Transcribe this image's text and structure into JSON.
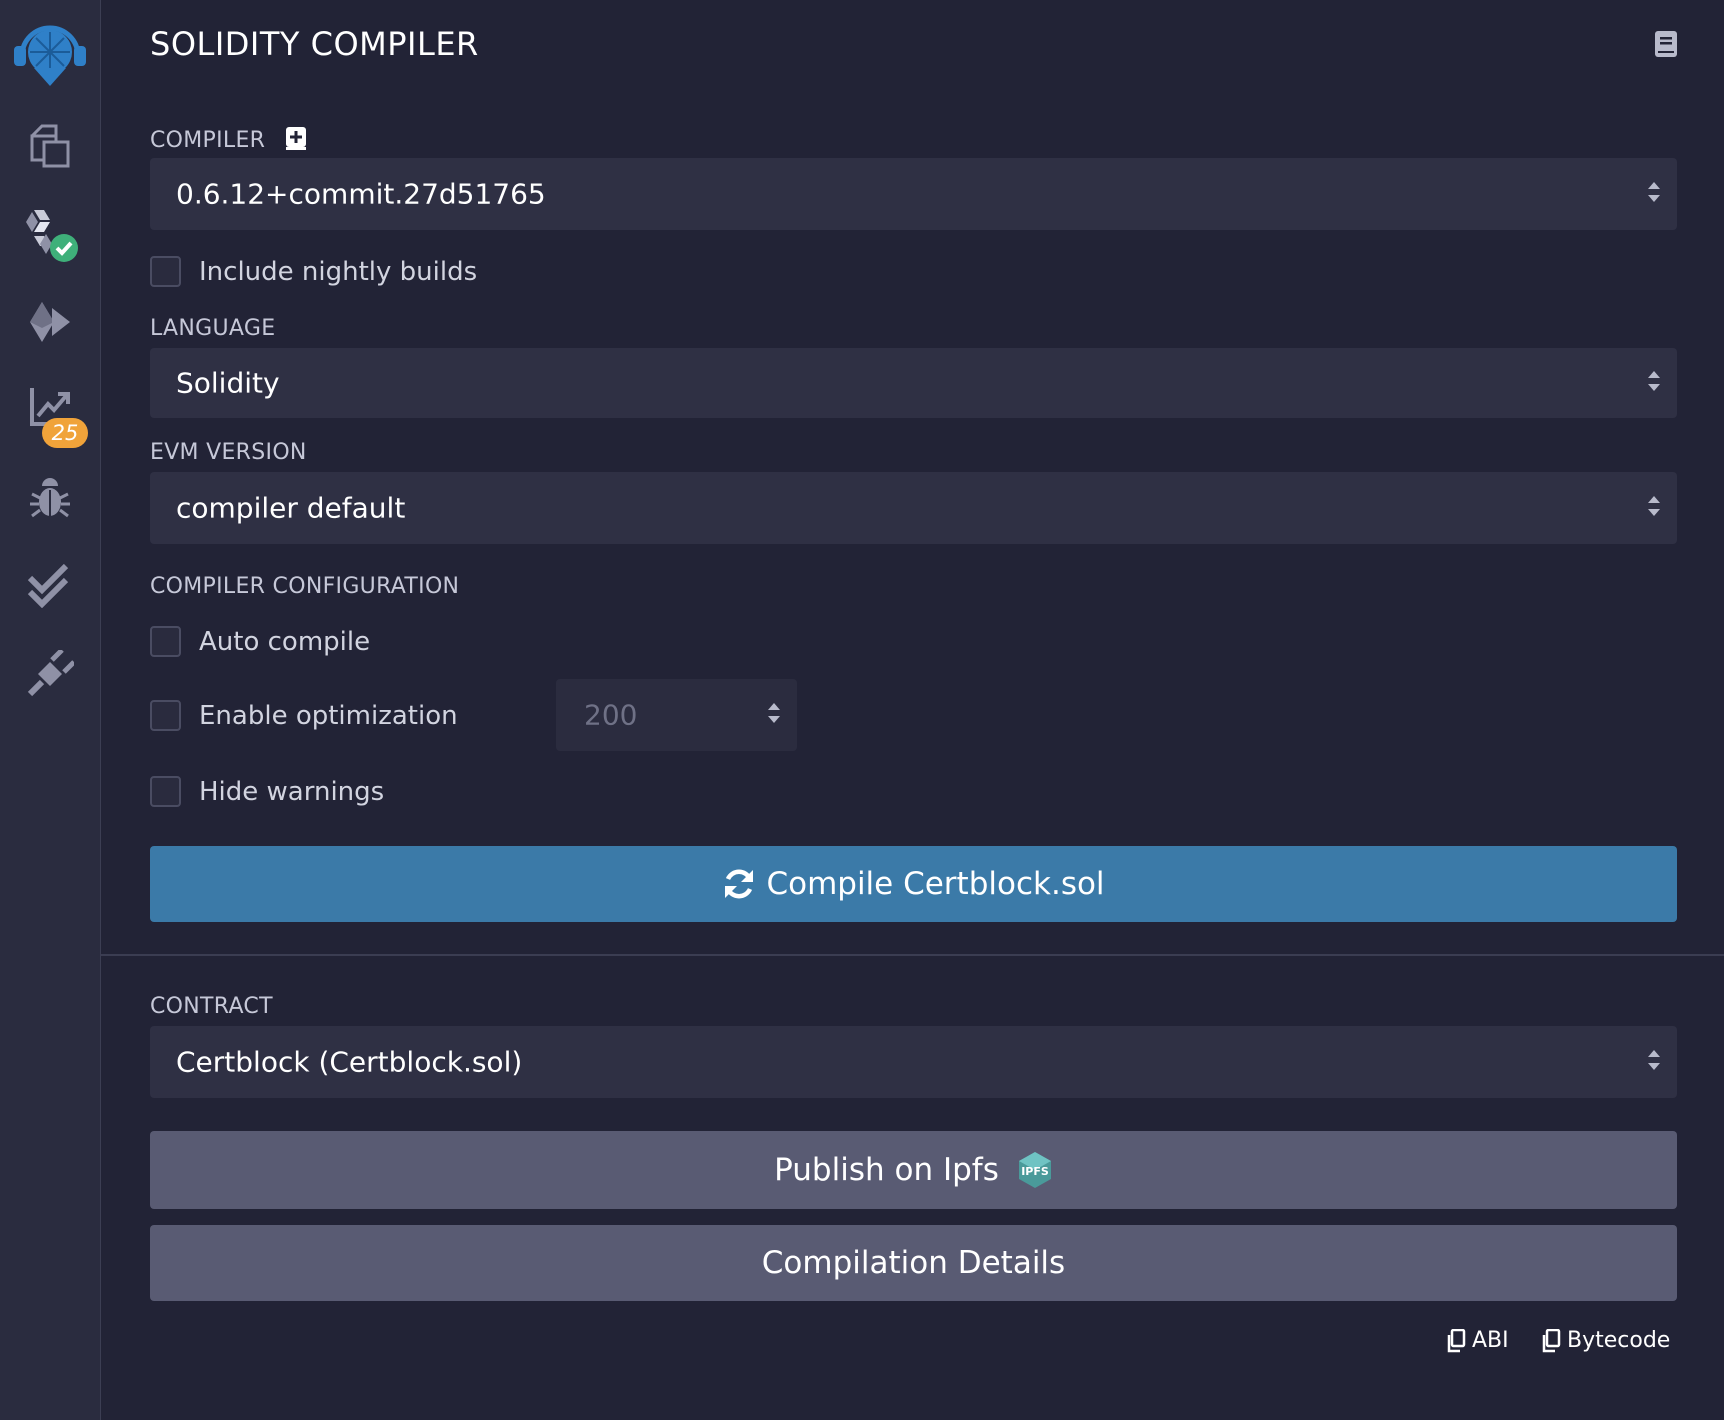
{
  "sidebar": {
    "items": [
      {
        "name": "remix-logo-icon"
      },
      {
        "name": "file-explorer-icon"
      },
      {
        "name": "solidity-compiler-icon"
      },
      {
        "name": "deploy-run-icon"
      },
      {
        "name": "analysis-icon",
        "badge": "25"
      },
      {
        "name": "debugger-icon"
      },
      {
        "name": "unit-testing-icon"
      },
      {
        "name": "plugin-manager-icon"
      }
    ],
    "badge_color": "#f0a33a",
    "success_color": "#3fb07a"
  },
  "panel": {
    "title": "SOLIDITY COMPILER",
    "doc_icon": "book-icon"
  },
  "compiler": {
    "label": "COMPILER",
    "add_icon": "plus-square-icon",
    "value": "0.6.12+commit.27d51765",
    "nightly_label": "Include nightly builds",
    "nightly_checked": false
  },
  "language": {
    "label": "LANGUAGE",
    "value": "Solidity"
  },
  "evm": {
    "label": "EVM VERSION",
    "value": "compiler default"
  },
  "config": {
    "label": "COMPILER CONFIGURATION",
    "auto_compile_label": "Auto compile",
    "auto_compile_checked": false,
    "optimization_label": "Enable optimization",
    "optimization_checked": false,
    "runs_value": "200",
    "hide_warnings_label": "Hide warnings",
    "hide_warnings_checked": false
  },
  "compile_button": {
    "label": "Compile Certblock.sol",
    "icon": "refresh-icon",
    "color": "#3b7aa8"
  },
  "contract": {
    "label": "CONTRACT",
    "value": "Certblock (Certblock.sol)"
  },
  "publish_button": {
    "label": "Publish on Ipfs",
    "icon_text": "IPFS"
  },
  "details_button": {
    "label": "Compilation Details"
  },
  "copy_links": {
    "abi": "ABI",
    "bytecode": "Bytecode"
  }
}
